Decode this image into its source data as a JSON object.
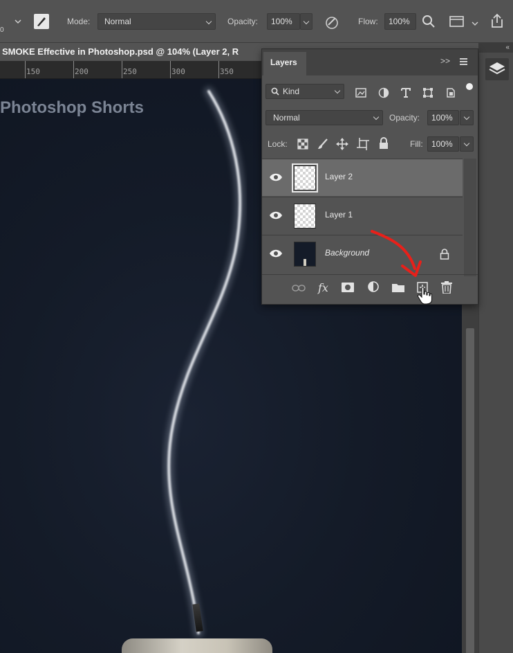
{
  "options_bar": {
    "mode_label": "Mode:",
    "mode_value": "Normal",
    "opacity_label": "Opacity:",
    "opacity_value": "100%",
    "flow_label": "Flow:",
    "flow_value": "100%",
    "brush_size_fragment": "0"
  },
  "document": {
    "tab_title": "SMOKE Effective in Photoshop.psd @ 104% (Layer 2, R",
    "ruler_ticks": [
      "150",
      "200",
      "250",
      "300",
      "350"
    ]
  },
  "canvas": {
    "watermark": "Photoshop Shorts",
    "background_color": "#141b28"
  },
  "layers_panel": {
    "tab_label": "Layers",
    "expand_label": ">>",
    "filter": {
      "label": "Kind"
    },
    "blend_mode": "Normal",
    "opacity_label": "Opacity:",
    "opacity_value": "100%",
    "lock_label": "Lock:",
    "fill_label": "Fill:",
    "fill_value": "100%",
    "layers": [
      {
        "name": "Layer 2",
        "visible": true,
        "selected": true
      },
      {
        "name": "Layer 1",
        "visible": true,
        "selected": false
      },
      {
        "name": "Background",
        "visible": true,
        "selected": false,
        "locked": true
      }
    ],
    "footer_icons": [
      "link-icon",
      "fx-icon",
      "mask-icon",
      "adjustment-icon",
      "group-folder-icon",
      "new-layer-icon",
      "trash-icon"
    ],
    "footer_fx_label": "fx"
  },
  "annotation": {
    "arrow_color": "#e8201a"
  }
}
